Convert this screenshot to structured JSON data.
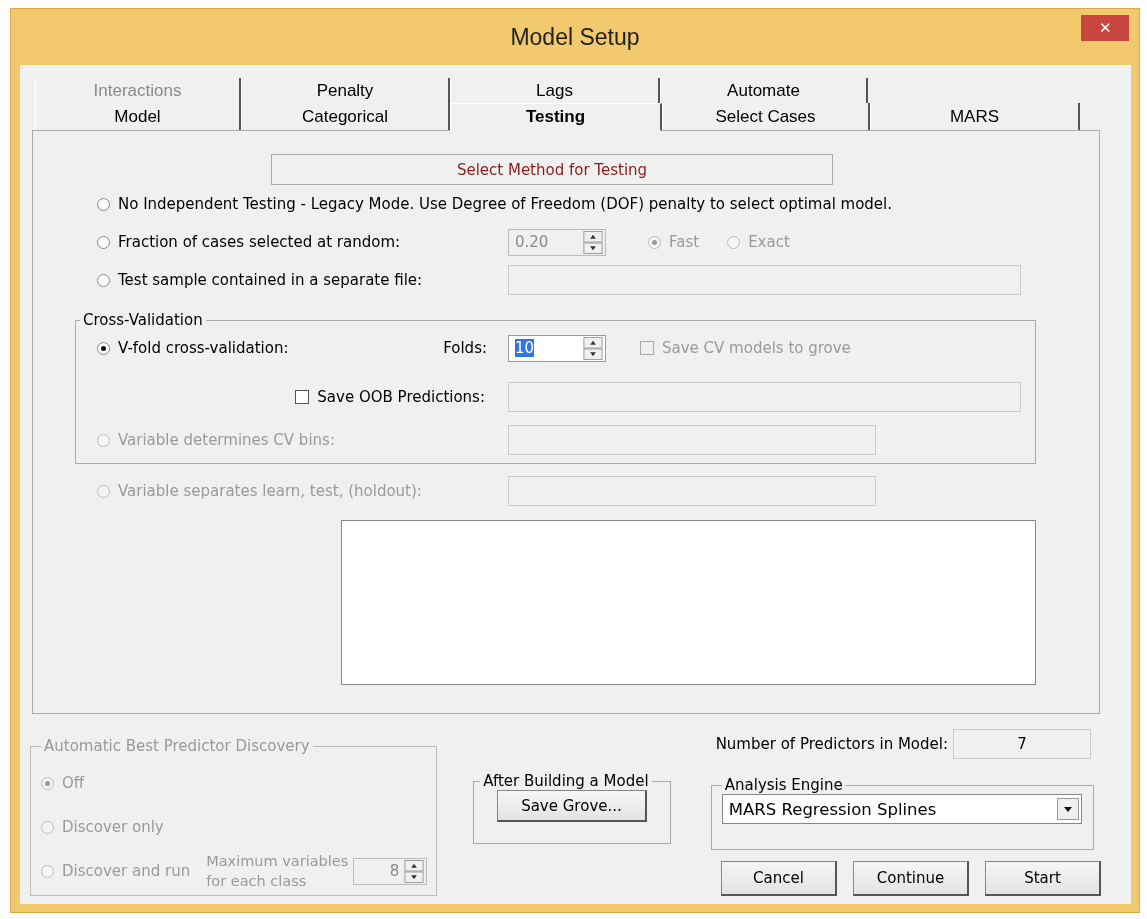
{
  "window": {
    "title": "Model Setup",
    "close": "✕"
  },
  "tab_rows": [
    {
      "tabs": [
        {
          "label": "Interactions",
          "selected": false,
          "disabled": true
        },
        {
          "label": "Penalty",
          "selected": false,
          "disabled": false
        },
        {
          "label": "Lags",
          "selected": false,
          "disabled": false
        },
        {
          "label": "Automate",
          "selected": false,
          "disabled": false
        }
      ]
    },
    {
      "tabs": [
        {
          "label": "Model",
          "selected": false,
          "disabled": false
        },
        {
          "label": "Categorical",
          "selected": false,
          "disabled": false
        },
        {
          "label": "Testing",
          "selected": true,
          "disabled": false
        },
        {
          "label": "Select Cases",
          "selected": false,
          "disabled": false
        },
        {
          "label": "MARS",
          "selected": false,
          "disabled": false
        }
      ]
    }
  ],
  "testing": {
    "heading": "Select Method for Testing",
    "no_testing": {
      "label": "No Independent Testing - Legacy Mode. Use Degree of Freedom (DOF) penalty to select optimal model.",
      "selected": false
    },
    "fraction": {
      "label": "Fraction of cases selected at random:",
      "selected": false,
      "value": "0.20",
      "value_disabled": true,
      "modes": [
        {
          "label": "Fast",
          "selected": true,
          "disabled": true
        },
        {
          "label": "Exact",
          "selected": false,
          "disabled": true
        }
      ]
    },
    "separate_file": {
      "label": "Test sample contained in a separate file:",
      "selected": false
    },
    "cross_validation": {
      "title": "Cross-Validation",
      "vfold": {
        "label": "V-fold cross-validation:",
        "selected": true,
        "folds_label": "Folds:",
        "folds": "10"
      },
      "save_cv": {
        "label": "Save CV models to grove",
        "checked": false,
        "disabled": true
      },
      "save_oob": {
        "label": "Save OOB Predictions:",
        "checked": false
      },
      "cv_bins": {
        "label": "Variable determines CV bins:",
        "selected": false,
        "disabled": true
      }
    },
    "holdout": {
      "label": "Variable separates learn, test, (holdout):",
      "selected": false,
      "disabled": true
    }
  },
  "discovery": {
    "title": "Automatic Best Predictor Discovery",
    "disabled": true,
    "options": [
      {
        "label": "Off",
        "selected": true
      },
      {
        "label": "Discover only",
        "selected": false
      },
      {
        "label": "Discover and run",
        "selected": false
      }
    ],
    "max_label": "Maximum variables for each class",
    "max_value": "8"
  },
  "after_build": {
    "title": "After Building a Model",
    "button": "Save Grove..."
  },
  "predictors": {
    "label": "Number of Predictors in Model:",
    "value": "7"
  },
  "engine": {
    "title": "Analysis Engine",
    "value": "MARS Regression Splines"
  },
  "buttons": [
    "Cancel",
    "Continue",
    "Start"
  ]
}
